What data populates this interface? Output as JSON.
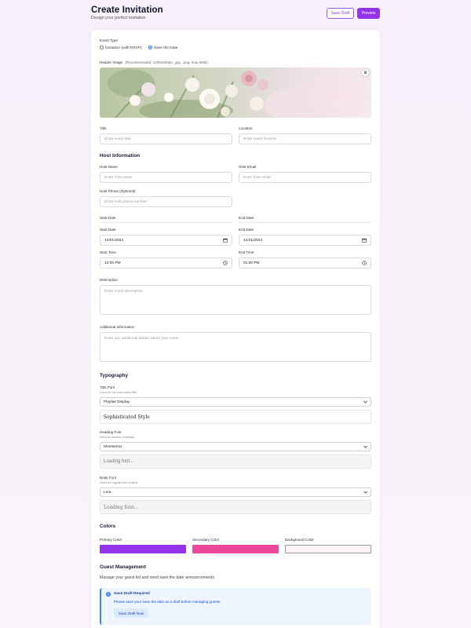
{
  "header": {
    "title": "Create Invitation",
    "subtitle": "Design your perfect invitation",
    "save_draft_label": "Save Draft",
    "preview_label": "Preview"
  },
  "event_type": {
    "label": "Event Type:",
    "options": [
      "Invitation (with RSVP)",
      "Save the Date"
    ],
    "selected": "Save the Date"
  },
  "header_image": {
    "label": "Header Image",
    "hint": "(Recommended: 1200x600px, .jpg, .png, max 5MB)",
    "remove_icon": "close-icon"
  },
  "title_field": {
    "label": "Title",
    "placeholder": "Enter event title"
  },
  "location_field": {
    "label": "Location",
    "placeholder": "Enter event location"
  },
  "host": {
    "section_title": "Host Information",
    "name_label": "Host Name",
    "name_placeholder": "Enter host name",
    "email_label": "Host Email",
    "email_placeholder": "Enter host email",
    "phone_label": "Host Phone (Optional)",
    "phone_placeholder": "Enter host phone number"
  },
  "dates": {
    "start_date_heading": "Start Date",
    "end_date_heading": "End Date",
    "start_date_label": "Start Date",
    "start_date_value": "12/01/2024",
    "end_date_label": "End Date",
    "end_date_value": "12/21/2024",
    "start_time_label": "Start Time",
    "start_time_value": "12:00 PM",
    "end_time_label": "End Time",
    "end_time_value": "01:00 PM"
  },
  "description": {
    "label": "Description",
    "placeholder": "Enter event description"
  },
  "additional": {
    "label": "Additional Information",
    "placeholder": "Enter any additional details about your event"
  },
  "typography": {
    "section_title": "Typography",
    "title_font": {
      "label": "Title Font",
      "help": "Used for the main event title",
      "value": "Playfair Display",
      "preview": "Sophisticated Style"
    },
    "heading_font": {
      "label": "Heading Font",
      "help": "Used for section headings",
      "value": "Montserrat",
      "preview": "Loading font..."
    },
    "body_font": {
      "label": "Body Font",
      "help": "Used for regular text content",
      "value": "Lora",
      "preview": "Loading font..."
    }
  },
  "colors": {
    "section_title": "Colors",
    "primary_label": "Primary Color",
    "primary": "#9333ea",
    "secondary_label": "Secondary Color",
    "secondary": "#ec4899",
    "background_label": "Background Color",
    "background": "#fdf2f8"
  },
  "guests": {
    "section_title": "Guest Management",
    "description": "Manage your guest list and send save the date announcements",
    "notice_title": "Save Draft Required",
    "notice_text": "Please save your save the date as a draft before managing guests.",
    "notice_button": "Save Draft Now",
    "notice_icon": "info-icon"
  }
}
